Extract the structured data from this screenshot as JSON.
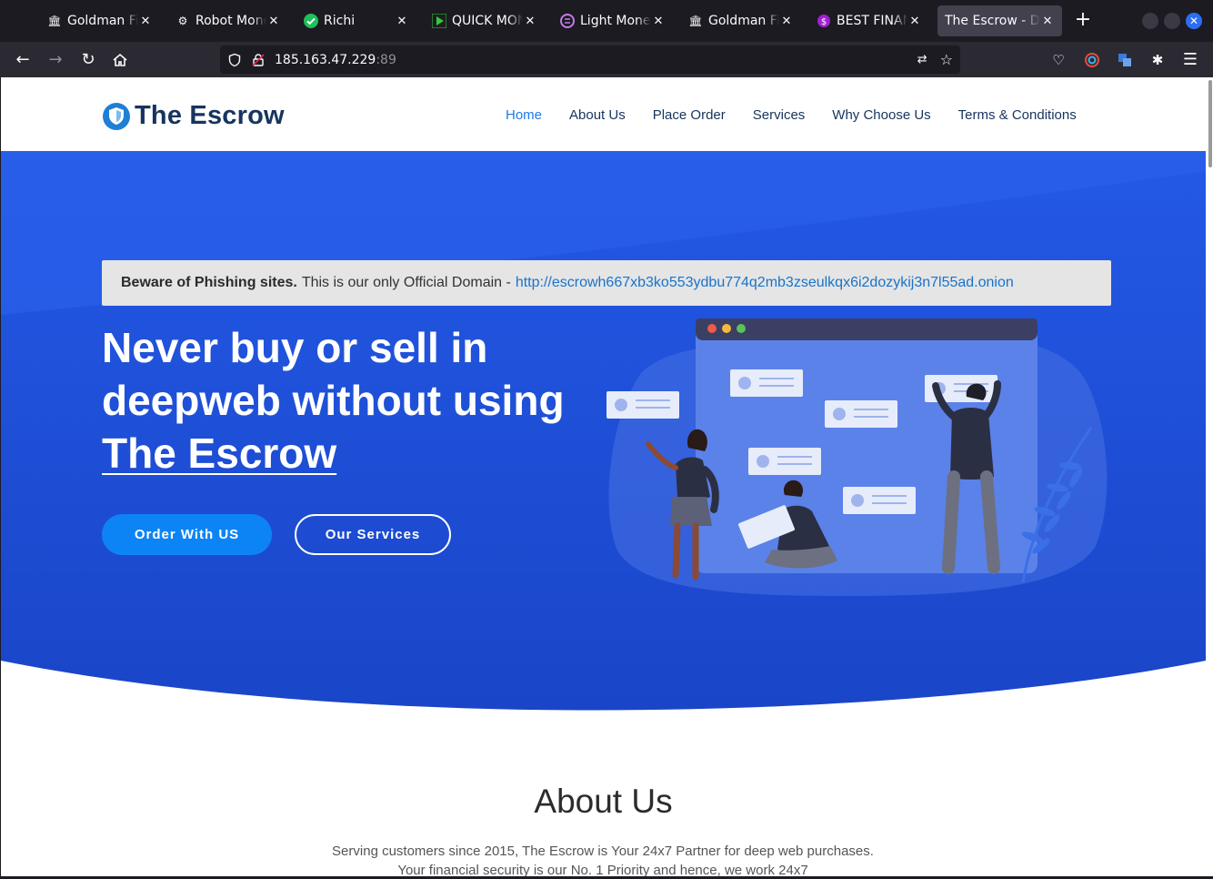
{
  "browser": {
    "tabs": [
      {
        "title": "Goldman Finance",
        "icon": "bank-icon"
      },
      {
        "title": "Robot Money",
        "icon": "robot-icon"
      },
      {
        "title": "Richi",
        "icon": "check-icon"
      },
      {
        "title": "QUICK MONEY",
        "icon": "play-icon"
      },
      {
        "title": "Light Money",
        "icon": "coin-icon"
      },
      {
        "title": "Goldman Finance",
        "icon": "bank-icon"
      },
      {
        "title": "BEST FINANCE",
        "icon": "dollar-icon"
      },
      {
        "title": "The Escrow - Darkweb",
        "icon": "none",
        "active": true
      }
    ],
    "url_host": "185.163.47.229",
    "url_port": ":89"
  },
  "site": {
    "logo_text": "The Escrow",
    "nav": [
      "Home",
      "About Us",
      "Place Order",
      "Services",
      "Why Choose Us",
      "Terms & Conditions"
    ],
    "notice": {
      "bold": "Beware of Phishing sites.",
      "text": "This is our only Official Domain -",
      "link": "http://escrowh667xb3ko553ydbu774q2mb3zseulkqx6i2dozykij3n7l55ad.onion"
    },
    "headline_part1": "Never buy or sell in deepweb without using ",
    "headline_highlight": "The Escrow",
    "cta_primary": "Order With US",
    "cta_secondary": "Our Services",
    "about_title": "About Us",
    "about_text": "Serving customers since 2015, The Escrow is Your 24x7 Partner for deep web purchases. Your financial security is our No. 1 Priority and hence, we work 24x7"
  },
  "colors": {
    "hero_blue": "#1d4fd8",
    "hero_dark": "#1a3fb8",
    "primary_button": "#0d84f5",
    "nav_active": "#1e7ae8",
    "logo_text": "#16345e"
  }
}
